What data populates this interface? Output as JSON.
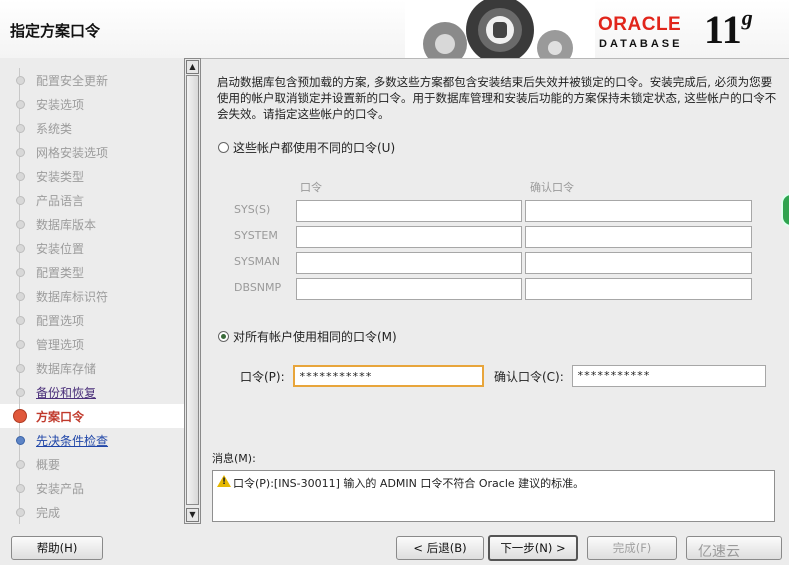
{
  "window": {
    "title": "指定方案口令"
  },
  "brand": {
    "oracle": "ORACLE",
    "database": "DATABASE",
    "version_num": "11",
    "version_letter": "g"
  },
  "steps": [
    {
      "label": "配置安全更新",
      "state": "done"
    },
    {
      "label": "安装选项",
      "state": "done"
    },
    {
      "label": "系统类",
      "state": "done"
    },
    {
      "label": "网格安装选项",
      "state": "done"
    },
    {
      "label": "安装类型",
      "state": "done"
    },
    {
      "label": "产品语言",
      "state": "done"
    },
    {
      "label": "数据库版本",
      "state": "done"
    },
    {
      "label": "安装位置",
      "state": "done"
    },
    {
      "label": "配置类型",
      "state": "done"
    },
    {
      "label": "数据库标识符",
      "state": "done"
    },
    {
      "label": "配置选项",
      "state": "done"
    },
    {
      "label": "管理选项",
      "state": "done"
    },
    {
      "label": "数据库存储",
      "state": "done"
    },
    {
      "label": "备份和恢复",
      "state": "visited"
    },
    {
      "label": "方案口令",
      "state": "active"
    },
    {
      "label": "先决条件检查",
      "state": "link"
    },
    {
      "label": "概要",
      "state": "pending"
    },
    {
      "label": "安装产品",
      "state": "pending"
    },
    {
      "label": "完成",
      "state": "pending"
    }
  ],
  "intro": "启动数据库包含预加载的方案, 多数这些方案都包含安装结束后失效并被锁定的口令。安装完成后, 必须为您要使用的帐户取消锁定并设置新的口令。用于数据库管理和安装后功能的方案保持未锁定状态, 这些帐户的口令不会失效。请指定这些帐户的口令。",
  "options": {
    "different": "这些帐户都使用不同的口令(U)",
    "same": "对所有帐户使用相同的口令(M)",
    "selected": "same"
  },
  "table": {
    "col_password": "口令",
    "col_confirm": "确认口令",
    "rows": [
      "SYS(S)",
      "SYSTEM",
      "SYSMAN",
      "DBSNMP"
    ]
  },
  "same_password": {
    "password_label": "口令(P):",
    "password_value": "***********",
    "confirm_label": "确认口令(C):",
    "confirm_value": "***********"
  },
  "messages": {
    "label": "消息(M):",
    "text": "口令(P):[INS-30011] 输入的 ADMIN 口令不符合 Oracle 建议的标准。"
  },
  "buttons": {
    "help": "帮助(H)",
    "back": "< 后退(B)",
    "next": "下一步(N) >",
    "finish": "完成(F)"
  },
  "watermark": "亿速云"
}
